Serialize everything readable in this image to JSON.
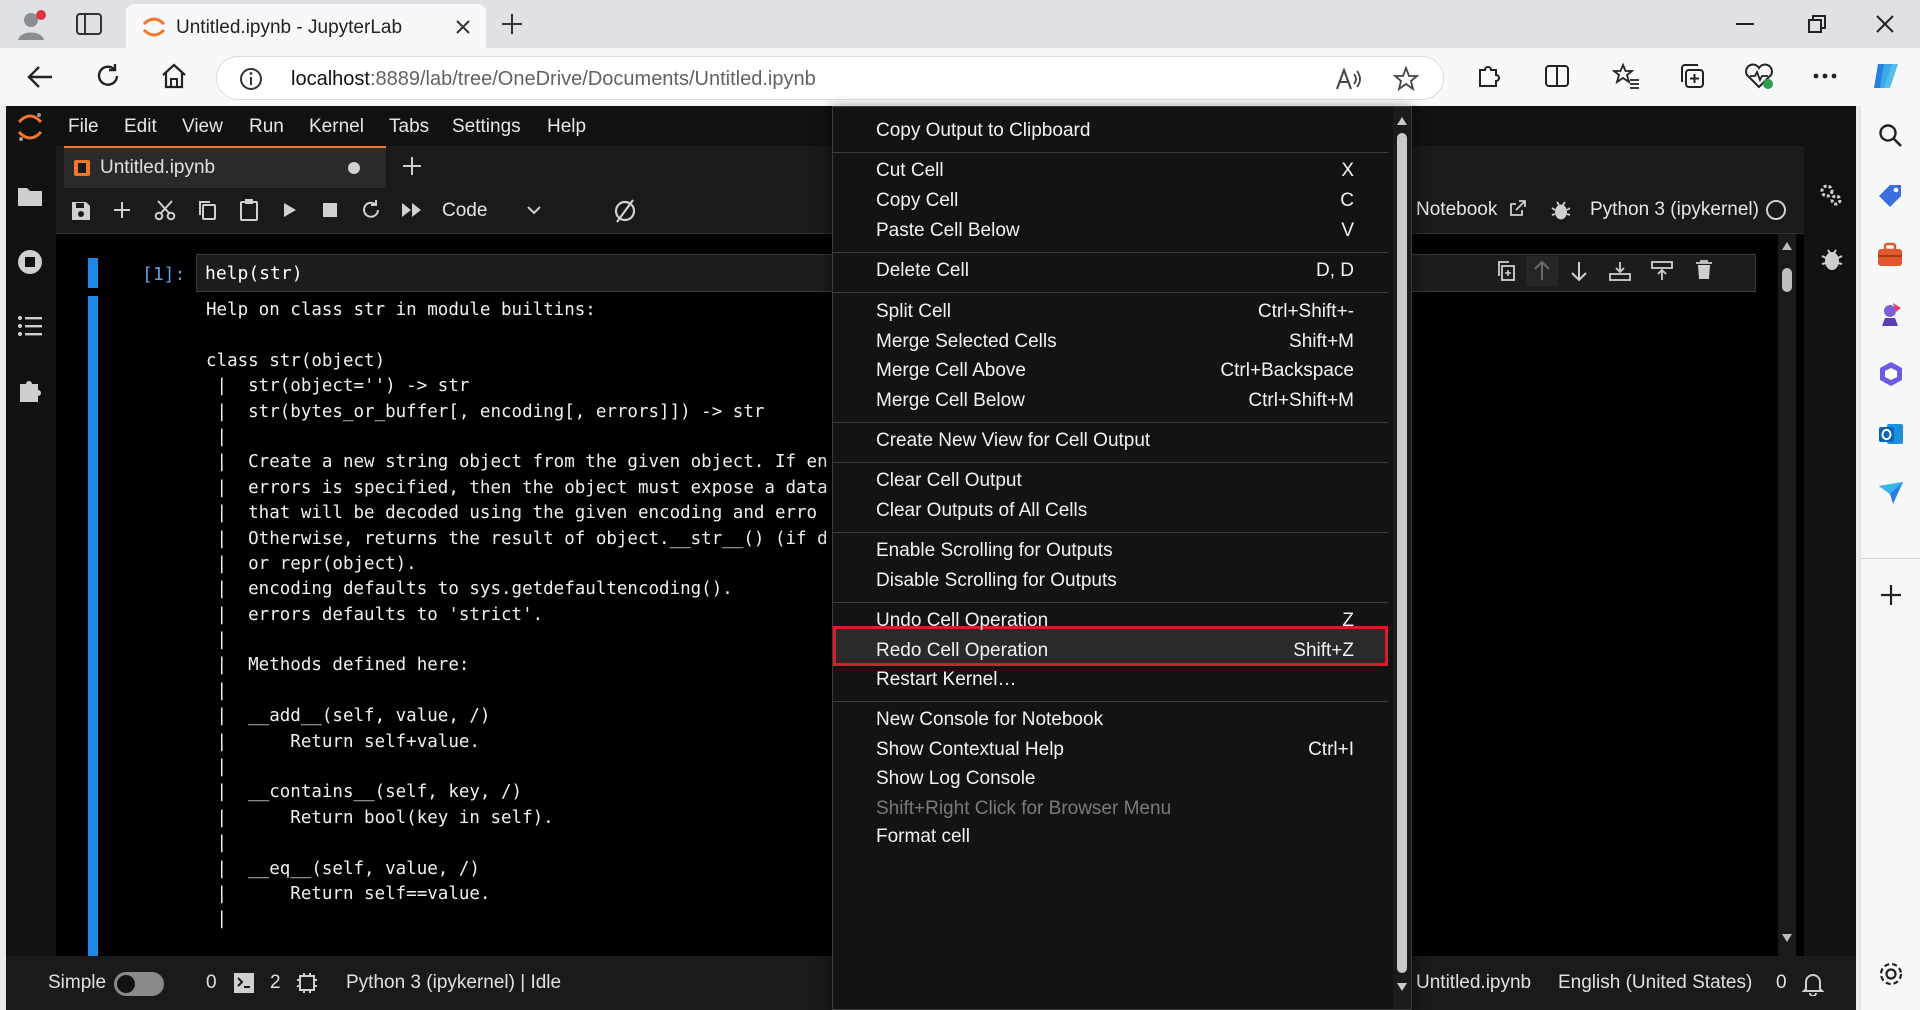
{
  "browser": {
    "tab_title": "Untitled.ipynb - JupyterLab",
    "url_host": "localhost",
    "url_path": ":8889/lab/tree/OneDrive/Documents/Untitled.ipynb",
    "icons": [
      "profile-icon",
      "tab-actions-icon",
      "jupyter-favicon",
      "close-tab-icon",
      "new-tab-icon",
      "minimize-icon",
      "restore-icon",
      "close-window-icon",
      "back-icon",
      "refresh-icon",
      "home-icon",
      "site-info-icon",
      "read-aloud-icon",
      "favorite-star-icon",
      "extensions-icon",
      "split-screen-icon",
      "favorites-icon",
      "collections-icon",
      "browser-essentials-icon",
      "more-icon",
      "copilot-icon"
    ]
  },
  "edge_sidebar": {
    "icons": [
      "search-icon",
      "shopping-tag-icon",
      "tools-icon",
      "games-icon",
      "microsoft-365-icon",
      "outlook-icon",
      "send-icon",
      "add-icon",
      "settings-icon"
    ]
  },
  "jupyter": {
    "menu": [
      "File",
      "Edit",
      "View",
      "Run",
      "Kernel",
      "Tabs",
      "Settings",
      "Help"
    ],
    "doc_tab": "Untitled.ipynb",
    "cell_type": "Code",
    "notebook_label": "Notebook",
    "kernel_name": "Python 3 (ipykernel)",
    "cell": {
      "prompt": "[1]:",
      "source": "help(str)",
      "output": [
        "Help on class str in module builtins:",
        "",
        "class str(object)",
        " |  str(object='') -> str",
        " |  str(bytes_or_buffer[, encoding[, errors]]) -> str",
        " |",
        " |  Create a new string object from the given object. If en",
        " |  errors is specified, then the object must expose a data",
        " |  that will be decoded using the given encoding and erro",
        " |  Otherwise, returns the result of object.__str__() (if d",
        " |  or repr(object).",
        " |  encoding defaults to sys.getdefaultencoding().",
        " |  errors defaults to 'strict'.",
        " |",
        " |  Methods defined here:",
        " |",
        " |  __add__(self, value, /)",
        " |      Return self+value.",
        " |",
        " |  __contains__(self, key, /)",
        " |      Return bool(key in self).",
        " |",
        " |  __eq__(self, value, /)",
        " |      Return self==value.",
        " |"
      ]
    },
    "status": {
      "mode": "Simple",
      "terminals": "0",
      "kernels": "2",
      "kernel_status": "Python 3 (ipykernel) | Idle",
      "file": "Untitled.ipynb",
      "language": "English (United States)",
      "notifications": "0"
    }
  },
  "context_menu": {
    "items": [
      {
        "label": "Copy Output to Clipboard",
        "shortcut": ""
      },
      {
        "label": "Cut Cell",
        "shortcut": "X"
      },
      {
        "label": "Copy Cell",
        "shortcut": "C"
      },
      {
        "label": "Paste Cell Below",
        "shortcut": "V"
      },
      {
        "label": "Delete Cell",
        "shortcut": "D, D"
      },
      {
        "label": "Split Cell",
        "shortcut": "Ctrl+Shift+-"
      },
      {
        "label": "Merge Selected Cells",
        "shortcut": "Shift+M"
      },
      {
        "label": "Merge Cell Above",
        "shortcut": "Ctrl+Backspace"
      },
      {
        "label": "Merge Cell Below",
        "shortcut": "Ctrl+Shift+M"
      },
      {
        "label": "Create New View for Cell Output",
        "shortcut": ""
      },
      {
        "label": "Clear Cell Output",
        "shortcut": ""
      },
      {
        "label": "Clear Outputs of All Cells",
        "shortcut": ""
      },
      {
        "label": "Enable Scrolling for Outputs",
        "shortcut": ""
      },
      {
        "label": "Disable Scrolling for Outputs",
        "shortcut": ""
      },
      {
        "label": "Undo Cell Operation",
        "shortcut": "Z"
      },
      {
        "label": "Redo Cell Operation",
        "shortcut": "Shift+Z"
      },
      {
        "label": "Restart Kernel…",
        "shortcut": ""
      },
      {
        "label": "New Console for Notebook",
        "shortcut": ""
      },
      {
        "label": "Show Contextual Help",
        "shortcut": "Ctrl+I"
      },
      {
        "label": "Show Log Console",
        "shortcut": ""
      },
      {
        "label": "Shift+Right Click for Browser Menu",
        "shortcut": ""
      },
      {
        "label": "Format cell",
        "shortcut": ""
      }
    ],
    "highlighted": "Enable Scrolling for Outputs"
  },
  "colors": {
    "accent_orange": "#f37726",
    "cell_blue": "#1e88e5",
    "highlight_red": "#d21f2a"
  }
}
